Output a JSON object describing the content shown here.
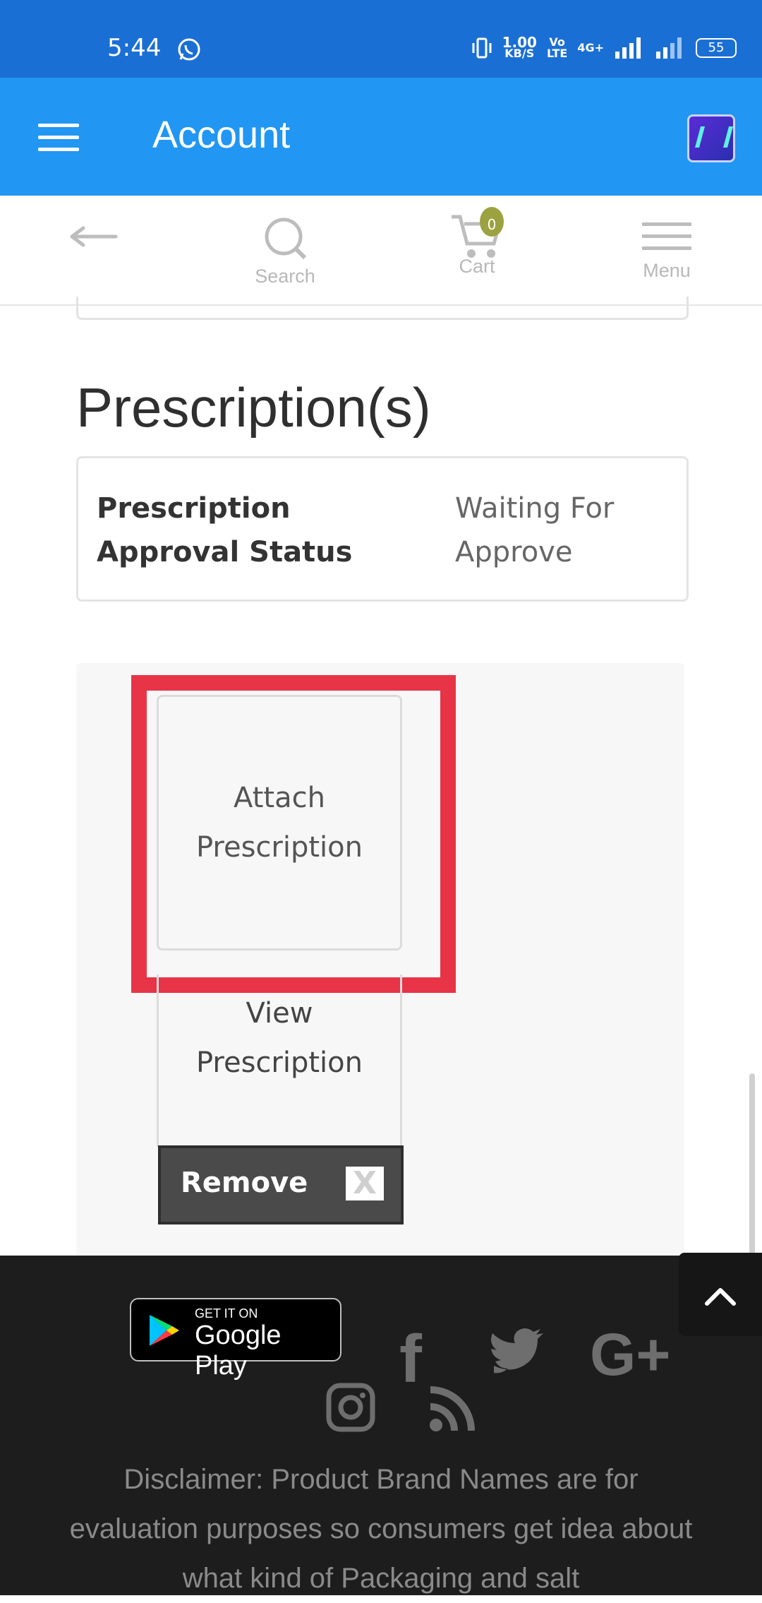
{
  "status_bar": {
    "time": "5:44",
    "net_speed_top": "1.00",
    "net_speed_bottom": "KB/S",
    "volte_top": "Vo",
    "volte_bottom": "LTE",
    "network": "4G+",
    "battery": "55"
  },
  "app_bar": {
    "title": "Account",
    "menu_icon": "hamburger-icon",
    "logo_icon": "app-logo"
  },
  "nav": {
    "back_icon": "back-arrow-icon",
    "search_label": "Search",
    "cart_label": "Cart",
    "cart_count": "0",
    "menu_label": "Menu"
  },
  "content": {
    "heading": "Prescription(s)",
    "status_label": "Prescription Approval Status",
    "status_value": "Waiting For Approve",
    "attach_label": "Attach Prescription",
    "view_label": "View Prescription",
    "remove_label": "Remove",
    "remove_x": "X",
    "highlight_color": "#e83447"
  },
  "footer": {
    "gplay_small": "GET IT ON",
    "gplay_big": "Google Play",
    "social_icons": [
      "facebook-icon",
      "twitter-icon",
      "google-plus-icon",
      "instagram-icon",
      "rss-icon"
    ],
    "disclaimer": "Disclaimer: Product Brand Names are for evaluation purposes so consumers get idea about what kind of Packaging and salt"
  }
}
